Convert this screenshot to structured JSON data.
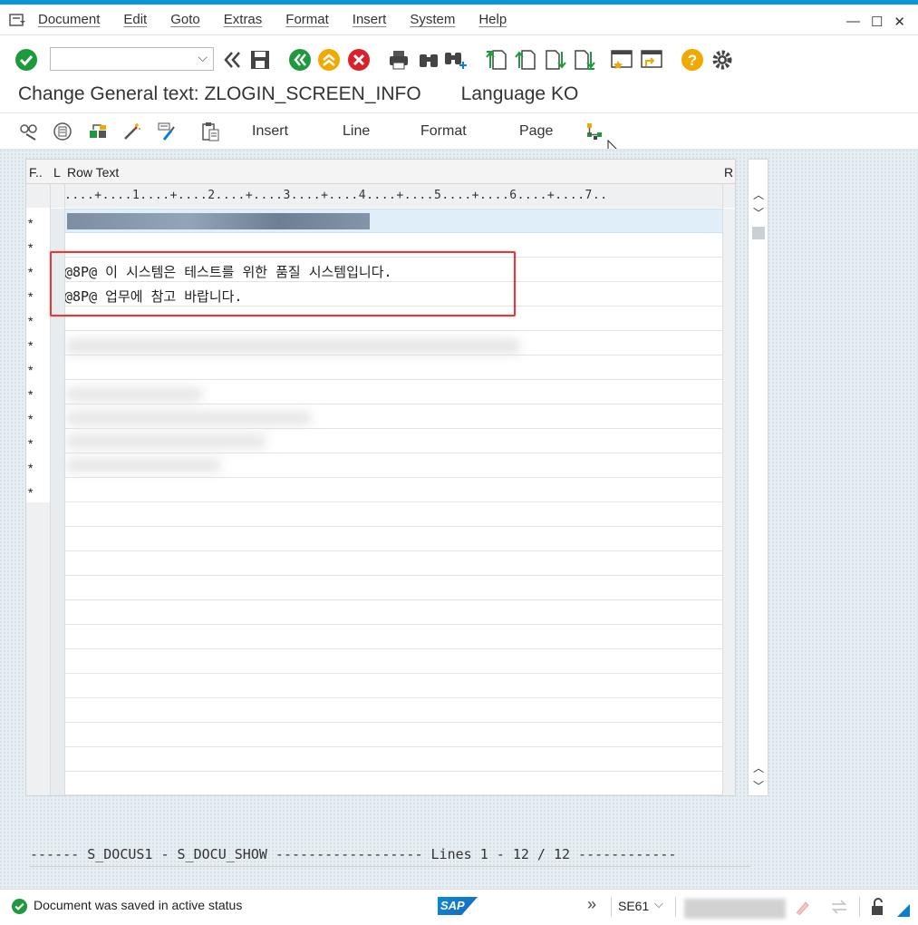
{
  "menubar": {
    "items": [
      "Document",
      "Edit",
      "Goto",
      "Extras",
      "Format",
      "Insert",
      "System",
      "Help"
    ]
  },
  "window_controls": {
    "minimize": "—",
    "maximize": "☐",
    "close": "✕"
  },
  "toolbar": {
    "command_field_value": "",
    "icons": [
      "enter-icon",
      "back-icon",
      "save-icon",
      "back-green-icon",
      "exit-icon",
      "cancel-icon",
      "print-icon",
      "find-icon",
      "find-next-icon",
      "first-page-icon",
      "previous-page-icon",
      "next-page-icon",
      "last-page-icon",
      "create-session-icon",
      "shortcut-icon",
      "help-icon",
      "settings-icon"
    ]
  },
  "title": {
    "text": "Change General text: ZLOGIN_SCREEN_INFO",
    "language": "Language KO"
  },
  "app_toolbar": {
    "insert": "Insert",
    "line": "Line",
    "format": "Format",
    "page": "Page"
  },
  "table": {
    "headers": {
      "f": "F..",
      "l": "L",
      "text": "Row Text",
      "r": "R"
    },
    "ruler": "....+....1....+....2....+....3....+....4....+....5....+....6....+....7..",
    "rows": [
      {
        "f": "*",
        "text": ""
      },
      {
        "f": "*",
        "text": ""
      },
      {
        "f": "*",
        "text": "@8P@ 이 시스템은 테스트를 위한 품질 시스템입니다."
      },
      {
        "f": "*",
        "text": "@8P@ 업무에 참고 바랍니다."
      },
      {
        "f": "*",
        "text": ""
      },
      {
        "f": "*",
        "text": ""
      },
      {
        "f": "*",
        "text": ""
      },
      {
        "f": "*",
        "text": ""
      },
      {
        "f": "*",
        "text": ""
      },
      {
        "f": "*",
        "text": ""
      },
      {
        "f": "*",
        "text": ""
      },
      {
        "f": "*",
        "text": ""
      }
    ]
  },
  "status_line": "------ S_DOCUS1 - S_DOCU_SHOW ------------------ Lines 1 - 12 / 12 ------------",
  "statusbar": {
    "message": "Document  was saved in active status",
    "sap_logo": "SAP",
    "transaction": "SE61"
  }
}
